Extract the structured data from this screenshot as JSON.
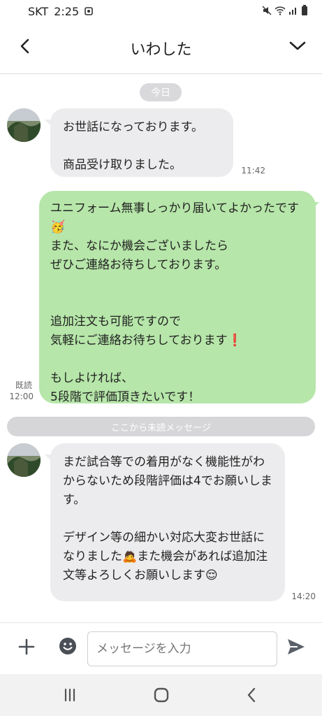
{
  "status_bar": {
    "carrier": "SKT",
    "time": "2:25"
  },
  "header": {
    "title": "いわした"
  },
  "chat": {
    "date_chip": "今日",
    "messages": [
      {
        "direction": "in",
        "text": "お世話になっております。\n\n商品受け取りました。",
        "time": "11:42"
      },
      {
        "direction": "out",
        "text": "ユニフォーム無事しっかり届いてよかったです🥳\nまた、なにか機会ございましたら\nぜひご連絡お待ちしております。\n\n\n追加注文も可能ですので\n気軽にご連絡お待ちしております❗\n\nもしよければ、\n5段階で評価頂きたいです！",
        "read_label": "既読",
        "time": "12:00"
      },
      {
        "direction": "in",
        "text": "まだ試合等での着用がなく機能性がわからないため段階評価は4でお願いします。\n\nデザイン等の細かい対応大変お世話になりました🙇また機会があれば追加注文等よろしくお願いします😌",
        "time": "14:20"
      }
    ],
    "unread_separator": "ここから未読メッセージ"
  },
  "input_bar": {
    "placeholder": "メッセージを入力"
  },
  "icons": {
    "back": "chevron-left-icon",
    "menu": "chevron-down-icon",
    "attach": "plus-icon",
    "emoji": "emoji-icon",
    "send": "send-icon",
    "recents": "recents-icon",
    "home": "home-icon",
    "nav_back": "back-icon"
  },
  "colors": {
    "outgoing_bubble": "#b6e6a9",
    "incoming_bubble": "#ececee",
    "separator": "#d6d6d9"
  }
}
